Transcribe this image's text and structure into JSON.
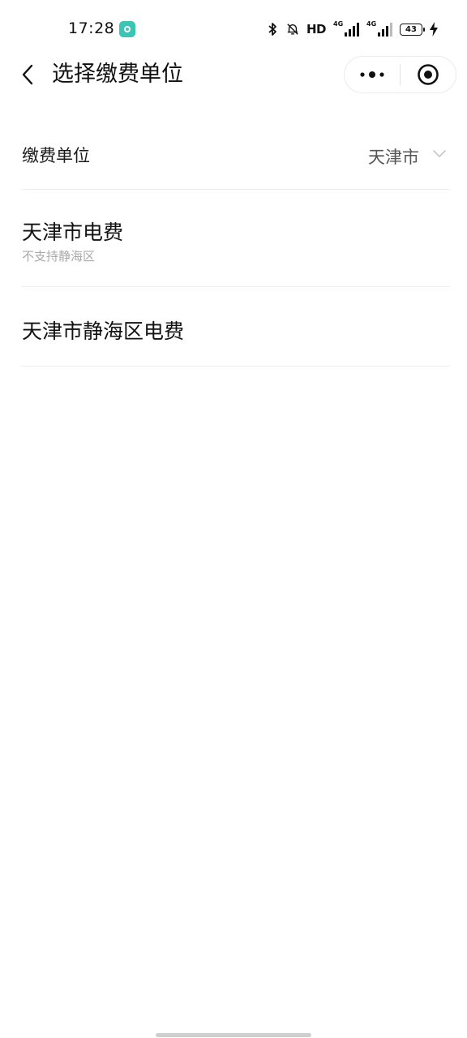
{
  "status_bar": {
    "time": "17:28",
    "hd_label": "HD",
    "sim1_network": "4G",
    "sim2_network": "4G",
    "battery_level": "43"
  },
  "header": {
    "title": "选择缴费单位"
  },
  "selector": {
    "label": "缴费单位",
    "value": "天津市"
  },
  "units": [
    {
      "name": "天津市电费",
      "note": "不支持静海区"
    },
    {
      "name": "天津市静海区电费"
    }
  ],
  "icons": {
    "back": "chevron-left-icon",
    "more": "more-dots-icon",
    "close": "target-circle-icon",
    "dropdown": "chevron-down-icon",
    "bluetooth": "bluetooth-icon",
    "mute": "bell-off-icon",
    "charging": "lightning-bolt-icon"
  },
  "colors": {
    "notification_badge": "#3cc4b4",
    "divider": "#ececec",
    "secondary_text": "#a8a8a8"
  }
}
